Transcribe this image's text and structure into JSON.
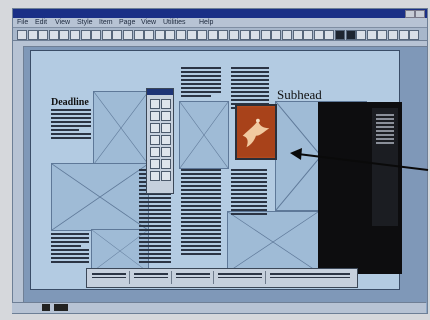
{
  "app": {
    "title": "",
    "menus": [
      "File",
      "Edit",
      "View",
      "Style",
      "Item",
      "Page",
      "View",
      "Utilities",
      "Help"
    ]
  },
  "document": {
    "headline": "Deadline",
    "subhead": "Subhead"
  },
  "colors": {
    "titlebar": "#1a2f86",
    "pasteboard": "#7f98b8",
    "page": "#b3cbe2",
    "picture": "#b24a1e",
    "black_panel": "#0d0d0f"
  },
  "icons": [
    "close-icon",
    "minimize-icon",
    "maximize-icon",
    "tool-palette",
    "arrow-icon"
  ]
}
